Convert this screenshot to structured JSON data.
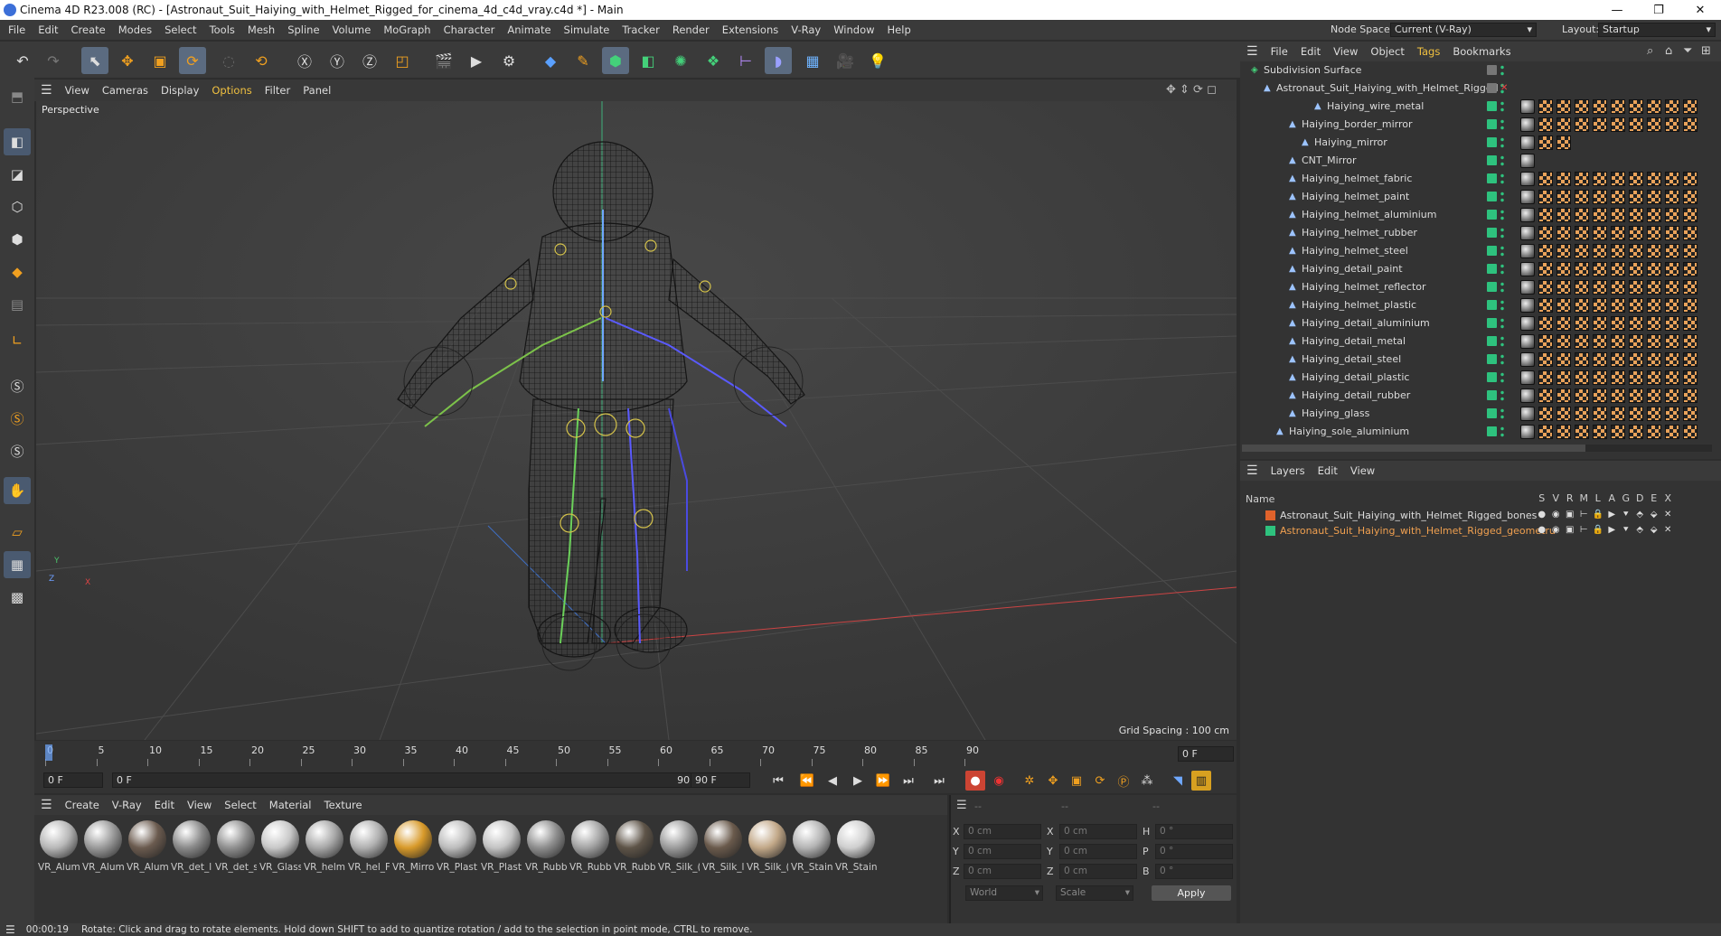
{
  "window": {
    "title": "Cinema 4D R23.008 (RC) - [Astronaut_Suit_Haiying_with_Helmet_Rigged_for_cinema_4d_c4d_vray.c4d *] - Main",
    "minimize": "—",
    "maximize": "❐",
    "close": "✕"
  },
  "menubar": {
    "items": [
      "File",
      "Edit",
      "Create",
      "Modes",
      "Select",
      "Tools",
      "Mesh",
      "Spline",
      "Volume",
      "MoGraph",
      "Character",
      "Animate",
      "Simulate",
      "Tracker",
      "Render",
      "Extensions",
      "V-Ray",
      "Window",
      "Help"
    ],
    "node_space_label": "Node Space:",
    "node_space_value": "Current (V-Ray)",
    "layout_label": "Layout:",
    "layout_value": "Startup"
  },
  "viewport": {
    "menu": [
      "View",
      "Cameras",
      "Display",
      "Options",
      "Filter",
      "Panel"
    ],
    "label": "Perspective",
    "grid_spacing": "Grid Spacing : 100 cm",
    "axis_x": "X",
    "axis_y": "Y",
    "axis_z": "Z"
  },
  "timeline": {
    "ticks": [
      "0",
      "5",
      "10",
      "15",
      "20",
      "25",
      "30",
      "35",
      "40",
      "45",
      "50",
      "55",
      "60",
      "65",
      "70",
      "75",
      "80",
      "85",
      "90"
    ],
    "current_frame_right": "0 F",
    "start_frame": "0 F",
    "range_start": "0 F",
    "range_end": "90 F",
    "end_frame": "90 F"
  },
  "materials": {
    "menu": [
      "Create",
      "V-Ray",
      "Edit",
      "View",
      "Select",
      "Material",
      "Texture"
    ],
    "items": [
      {
        "label": "VR_Alum",
        "color": "#b8b8b8"
      },
      {
        "label": "VR_Alum",
        "color": "#9a9a9a"
      },
      {
        "label": "VR_Alum",
        "color": "#6b5b4f"
      },
      {
        "label": "VR_det_l",
        "color": "#8a8a8a"
      },
      {
        "label": "VR_det_s",
        "color": "#909090"
      },
      {
        "label": "VR_Glass",
        "color": "#c8c8c8"
      },
      {
        "label": "VR_helm",
        "color": "#a8a8a8"
      },
      {
        "label": "VR_hel_F",
        "color": "#b0b0b0"
      },
      {
        "label": "VR_Mirro",
        "color": "#d89a2a"
      },
      {
        "label": "VR_Plast",
        "color": "#bdbdbd"
      },
      {
        "label": "VR_Plast",
        "color": "#c3c3c3"
      },
      {
        "label": "VR_Rubb",
        "color": "#8e8e8e"
      },
      {
        "label": "VR_Rubb",
        "color": "#a3a3a3"
      },
      {
        "label": "VR_Rubb",
        "color": "#5e5448"
      },
      {
        "label": "VR_Silk_(",
        "color": "#9c9c9c"
      },
      {
        "label": "VR_Silk_l",
        "color": "#6a5a4c"
      },
      {
        "label": "VR_Silk_(",
        "color": "#c2a888"
      },
      {
        "label": "VR_Stain",
        "color": "#b4b4b4"
      },
      {
        "label": "VR_Stain",
        "color": "#cfcfcf"
      }
    ]
  },
  "coords": {
    "hdr1": "--",
    "hdr2": "--",
    "hdr3": "--",
    "x": "X",
    "y": "Y",
    "z": "Z",
    "h": "H",
    "p": "P",
    "b": "B",
    "pos_x": "0 cm",
    "pos_y": "0 cm",
    "pos_z": "0 cm",
    "size_x": "0 cm",
    "size_y": "0 cm",
    "size_z": "0 cm",
    "rot_h": "0 °",
    "rot_p": "0 °",
    "rot_b": "0 °",
    "world": "World",
    "scale": "Scale",
    "apply": "Apply"
  },
  "objects": {
    "menu": [
      "File",
      "Edit",
      "View",
      "Object",
      "Tags",
      "Bookmarks"
    ],
    "rows": [
      {
        "name": "Subdivision Surface",
        "indent": 0,
        "tags": 0
      },
      {
        "name": "Astronaut_Suit_Haiying_with_Helmet_Rigged",
        "indent": 1,
        "tags": 0
      },
      {
        "name": "Haiying_wire_metal",
        "indent": 5,
        "tags": 10
      },
      {
        "name": "Haiying_border_mirror",
        "indent": 3,
        "tags": 10
      },
      {
        "name": "Haiying_mirror",
        "indent": 4,
        "tags": 3
      },
      {
        "name": "CNT_Mirror",
        "indent": 3,
        "tags": 1
      },
      {
        "name": "Haiying_helmet_fabric",
        "indent": 3,
        "tags": 10
      },
      {
        "name": "Haiying_helmet_paint",
        "indent": 3,
        "tags": 10
      },
      {
        "name": "Haiying_helmet_aluminium",
        "indent": 3,
        "tags": 10
      },
      {
        "name": "Haiying_helmet_rubber",
        "indent": 3,
        "tags": 10
      },
      {
        "name": "Haiying_helmet_steel",
        "indent": 3,
        "tags": 10
      },
      {
        "name": "Haiying_detail_paint",
        "indent": 3,
        "tags": 10
      },
      {
        "name": "Haiying_helmet_reflector",
        "indent": 3,
        "tags": 10
      },
      {
        "name": "Haiying_helmet_plastic",
        "indent": 3,
        "tags": 10
      },
      {
        "name": "Haiying_detail_aluminium",
        "indent": 3,
        "tags": 10
      },
      {
        "name": "Haiying_detail_metal",
        "indent": 3,
        "tags": 10
      },
      {
        "name": "Haiying_detail_steel",
        "indent": 3,
        "tags": 10
      },
      {
        "name": "Haiying_detail_plastic",
        "indent": 3,
        "tags": 10
      },
      {
        "name": "Haiying_detail_rubber",
        "indent": 3,
        "tags": 10
      },
      {
        "name": "Haiying_glass",
        "indent": 3,
        "tags": 10
      },
      {
        "name": "Haiying_sole_aluminium",
        "indent": 2,
        "tags": 10
      }
    ]
  },
  "layers": {
    "menu": [
      "Layers",
      "Edit",
      "View"
    ],
    "col_name": "Name",
    "cols": [
      "S",
      "V",
      "R",
      "M",
      "L",
      "A",
      "G",
      "D",
      "E",
      "X"
    ],
    "rows": [
      {
        "name": "Astronaut_Suit_Haiying_with_Helmet_Rigged_bones",
        "color": "#e0622b",
        "text_color": "#dcdcdc"
      },
      {
        "name": "Astronaut_Suit_Haiying_with_Helmet_Rigged_geometru",
        "color": "#2ec27e",
        "text_color": "#f0a050"
      }
    ]
  },
  "status": {
    "time": "00:00:19",
    "message": "Rotate: Click and drag to rotate elements. Hold down SHIFT to add to quantize rotation / add to the selection in point mode, CTRL to remove."
  }
}
